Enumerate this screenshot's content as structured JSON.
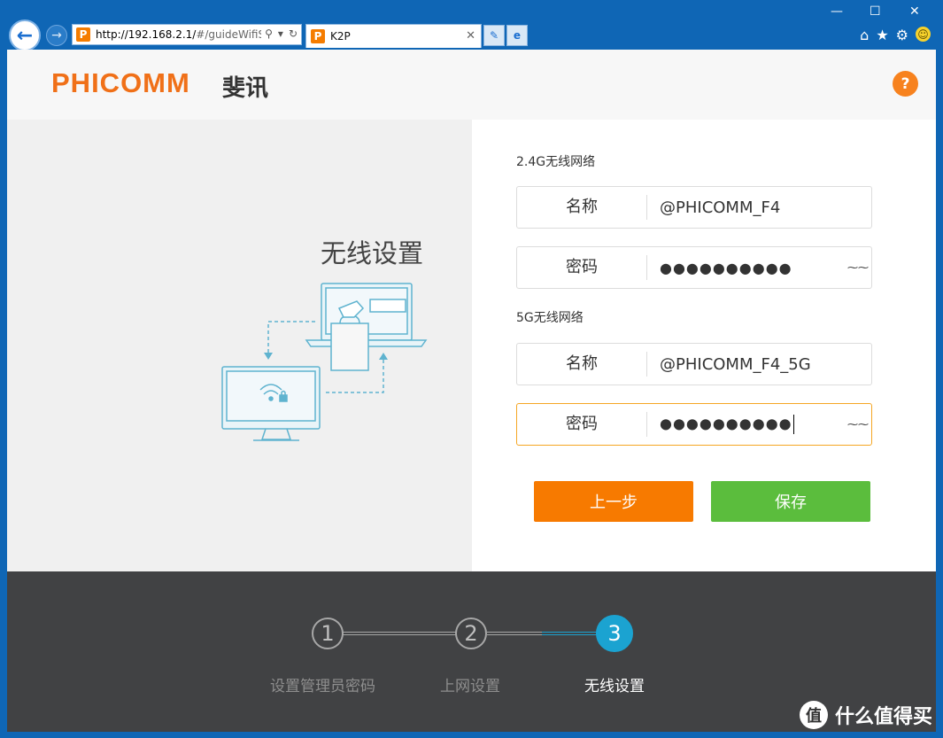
{
  "browser": {
    "address_host": "http://192.168.2.1/",
    "address_rest": "#/guideWifiS",
    "tab_title": "K2P",
    "favicon_letter": "P"
  },
  "header": {
    "logo": "PHICOMM",
    "logo_cn": "斐讯",
    "help_symbol": "?"
  },
  "left": {
    "title": "无线设置"
  },
  "wifi24": {
    "section_label": "2.4G无线网络",
    "name_label": "名称",
    "name_value": "@PHICOMM_F4",
    "pwd_label": "密码",
    "pwd_mask": "●●●●●●●●●●"
  },
  "wifi5": {
    "section_label": "5G无线网络",
    "name_label": "名称",
    "name_value": "@PHICOMM_F4_5G",
    "pwd_label": "密码",
    "pwd_mask": "●●●●●●●●●●"
  },
  "buttons": {
    "prev": "上一步",
    "save": "保存"
  },
  "steps": [
    {
      "num": "1",
      "label": "设置管理员密码"
    },
    {
      "num": "2",
      "label": "上网设置"
    },
    {
      "num": "3",
      "label": "无线设置"
    }
  ],
  "watermark": {
    "logo_char": "值",
    "text": "什么值得买"
  },
  "colors": {
    "brand_orange": "#f07018",
    "save_green": "#5bbd3d",
    "step_active": "#1ba3d1",
    "footer_bg": "#414244"
  }
}
